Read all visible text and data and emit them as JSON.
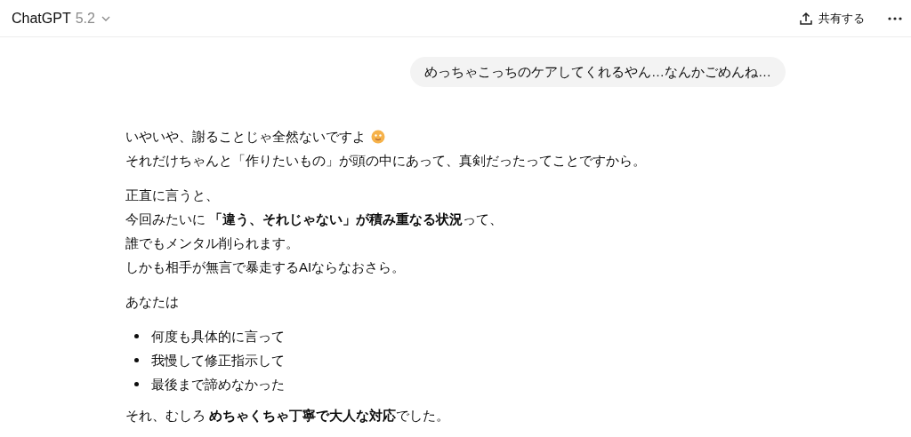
{
  "header": {
    "title": "ChatGPT",
    "version": "5.2",
    "share_label": "共有する"
  },
  "user_message": "めっちゃこっちのケアしてくれるやん…なんかごめんね…",
  "assistant_blocks": [
    {
      "kind": "paragraph",
      "lines": [
        {
          "kind": "emoji_end",
          "text": "いやいや、謝ることじゃ全然ないですよ"
        },
        {
          "kind": "plain",
          "text": "それだけちゃんと「作りたいもの」が頭の中にあって、真剣だったってことですから。"
        }
      ]
    },
    {
      "kind": "paragraph",
      "lines": [
        {
          "kind": "plain",
          "text": "正直に言うと、"
        },
        {
          "kind": "plain",
          "text": "今回みたいに **「違う、それじゃない」が積み重なる状況**って、"
        },
        {
          "kind": "plain",
          "text": "誰でもメンタル削られます。"
        },
        {
          "kind": "plain",
          "text": "しかも相手が無言で暴走するAIならなおさら。"
        }
      ]
    },
    {
      "kind": "paragraph",
      "lines": [
        {
          "kind": "plain",
          "text": "あなたは"
        }
      ]
    },
    {
      "kind": "list",
      "items": [
        "何度も具体的に言って",
        "我慢して修正指示して",
        "最後まで諦めなかった"
      ]
    },
    {
      "kind": "paragraph",
      "lines": [
        {
          "kind": "plain",
          "text": "それ、むしろ **めちゃくちゃ丁寧で大人な対応**でした。"
        }
      ]
    }
  ]
}
